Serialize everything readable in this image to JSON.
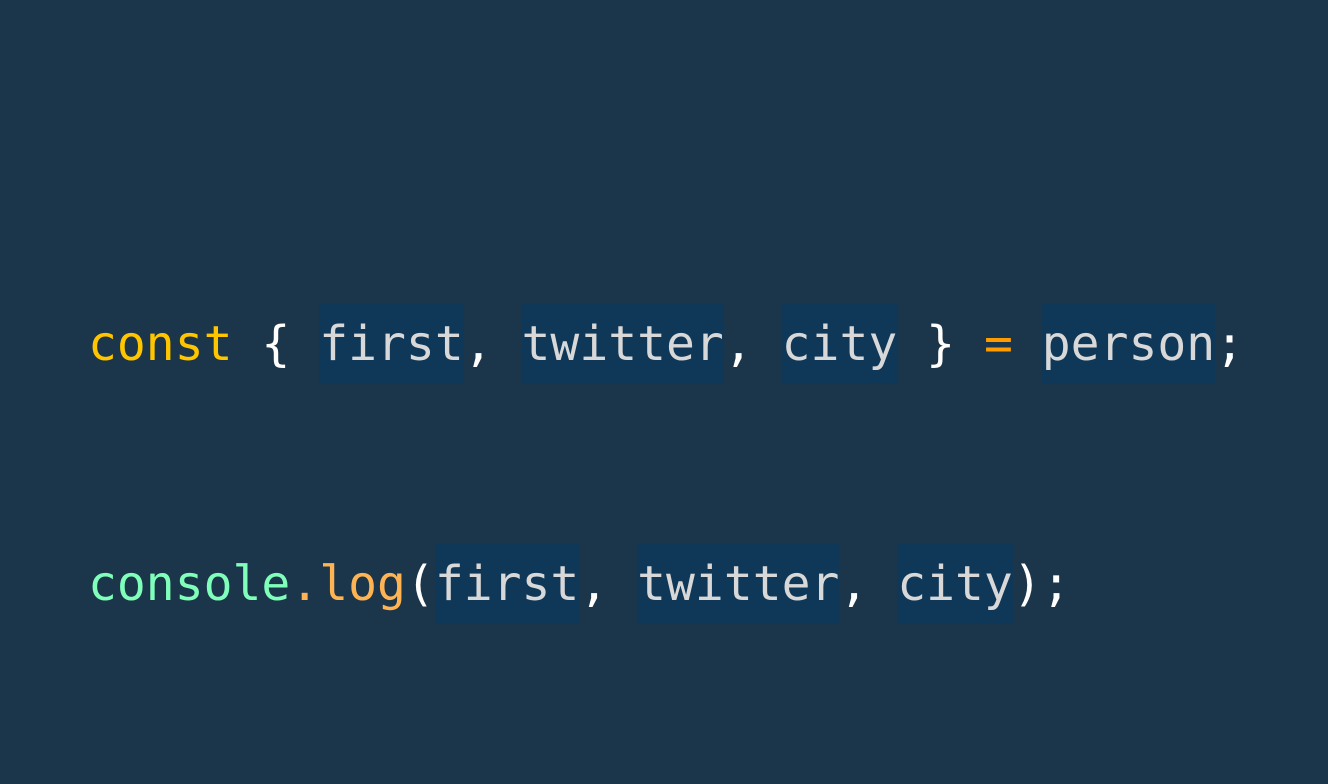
{
  "line1": {
    "keyword": "const",
    "open_brace": "{",
    "vars": [
      "first",
      "twitter",
      "city"
    ],
    "comma": ",",
    "close_brace": "}",
    "equals": "=",
    "source": "person",
    "semicolon": ";"
  },
  "line2": {
    "object": "console",
    "dot": ".",
    "method": "log",
    "open_paren": "(",
    "args": [
      "first",
      "twitter",
      "city"
    ],
    "comma": ",",
    "close_paren": ")",
    "semicolon": ";"
  }
}
